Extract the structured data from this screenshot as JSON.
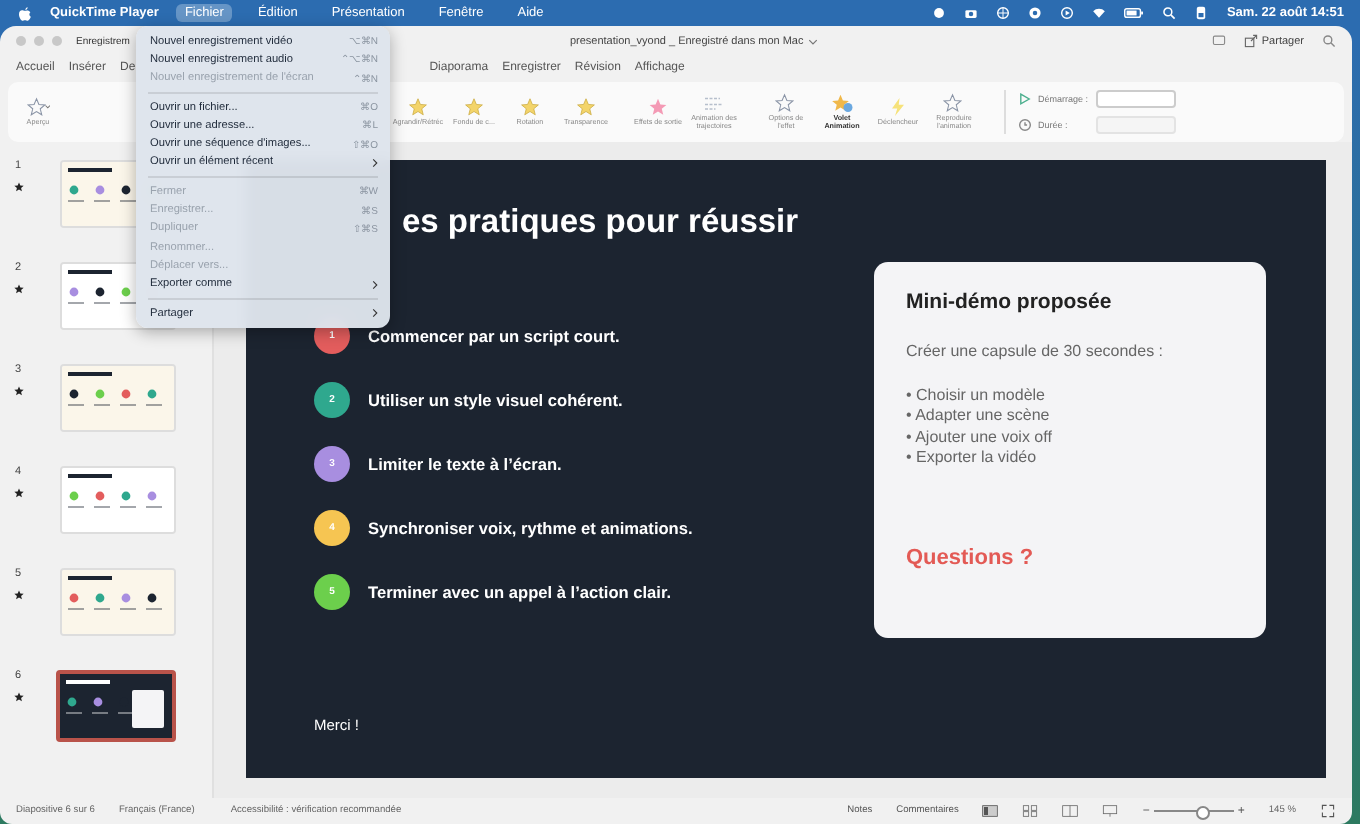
{
  "menu_bar": {
    "app": "QuickTime Player",
    "items": [
      {
        "label": "Fichier",
        "selected": true
      },
      {
        "label": "Édition",
        "selected": false
      },
      {
        "label": "Présentation",
        "selected": false
      },
      {
        "label": "Fenêtre",
        "selected": false
      },
      {
        "label": "Aide",
        "selected": false
      }
    ],
    "clock": "Sam. 22 août 14:51"
  },
  "window": {
    "left_tab": "Enregistrem",
    "title": "presentation_vyond _ Enregistré dans mon Mac",
    "share": "Partager"
  },
  "tabs": [
    {
      "label": "Accueil",
      "selected": false
    },
    {
      "label": "Insérer",
      "selected": false
    },
    {
      "label": "De",
      "selected": false
    },
    {
      "label": "Diaporama",
      "selected": false
    },
    {
      "label": "Enregistrer",
      "selected": false
    },
    {
      "label": "Révision",
      "selected": false
    },
    {
      "label": "Affichage",
      "selected": false
    }
  ],
  "ribbon": {
    "items": [
      {
        "label": "Aperçu"
      },
      {
        "label": "Agrandir/Rétréc"
      },
      {
        "label": "Fondu de c..."
      },
      {
        "label": "Rotation"
      },
      {
        "label": "Transparence"
      },
      {
        "label": "Effets de sortie"
      },
      {
        "label": "Animation des trajectoires"
      },
      {
        "label": "Options de l'effet"
      },
      {
        "label": "Volet Animation"
      },
      {
        "label": "Déclencheur"
      },
      {
        "label": "Reproduire l'animation"
      }
    ],
    "start_label": "Démarrage :",
    "duration_label": "Durée :"
  },
  "file_menu": {
    "items": [
      {
        "label": "Nouvel enregistrement vidéo",
        "shortcut": "⌥⌘N",
        "disabled": false,
        "submenu": false
      },
      {
        "label": "Nouvel enregistrement audio",
        "shortcut": "⌃⌥⌘N",
        "disabled": false,
        "submenu": false
      },
      {
        "label": "Nouvel enregistrement de l'écran",
        "shortcut": "⌃⌘N",
        "disabled": true,
        "submenu": false,
        "separator_after": true
      },
      {
        "label": "Ouvrir un fichier...",
        "shortcut": "⌘O",
        "disabled": false,
        "submenu": false
      },
      {
        "label": "Ouvrir une adresse...",
        "shortcut": "⌘L",
        "disabled": false,
        "submenu": false
      },
      {
        "label": "Ouvrir une séquence d'images...",
        "shortcut": "⇧⌘O",
        "disabled": false,
        "submenu": false
      },
      {
        "label": "Ouvrir un élément récent",
        "disabled": false,
        "submenu": true,
        "separator_after": true
      },
      {
        "label": "Fermer",
        "shortcut": "⌘W",
        "disabled": true,
        "submenu": false
      },
      {
        "label": "Enregistrer...",
        "shortcut": "⌘S",
        "disabled": true,
        "submenu": false
      },
      {
        "label": "Dupliquer",
        "shortcut": "⇧⌘S",
        "disabled": true,
        "submenu": false
      },
      {
        "label": "Renommer...",
        "disabled": true,
        "submenu": false
      },
      {
        "label": "Déplacer vers...",
        "disabled": true,
        "submenu": false
      },
      {
        "label": "Exporter comme",
        "disabled": false,
        "submenu": true,
        "separator_after": true
      },
      {
        "label": "Partager",
        "disabled": false,
        "submenu": true
      }
    ]
  },
  "slides_panel": {
    "slides": [
      {
        "number": "1",
        "kind": "cream",
        "selected": false
      },
      {
        "number": "2",
        "kind": "white",
        "selected": false
      },
      {
        "number": "3",
        "kind": "cream",
        "selected": false
      },
      {
        "number": "4",
        "kind": "white",
        "selected": false
      },
      {
        "number": "5",
        "kind": "cream",
        "selected": false
      },
      {
        "number": "6",
        "kind": "dark",
        "selected": true
      }
    ]
  },
  "slide": {
    "title": "es pratiques pour réussir",
    "steps": [
      {
        "number": "1",
        "text": "Commencer par un script court.",
        "color": "#e35d5d"
      },
      {
        "number": "2",
        "text": "Utiliser un style visuel cohérent.",
        "color": "#2fa88e"
      },
      {
        "number": "3",
        "text": "Limiter le texte à l’écran.",
        "color": "#a88ee0"
      },
      {
        "number": "4",
        "text": "Synchroniser voix, rythme et animations.",
        "color": "#f6c552"
      },
      {
        "number": "5",
        "text": "Terminer avec un appel à l’action clair.",
        "color": "#6ccf4c"
      }
    ],
    "card": {
      "title": "Mini-démo proposée",
      "intro": "Créer une capsule de 30 secondes :",
      "bullets": [
        "• Choisir un modèle",
        "• Adapter une scène",
        "• Ajouter une voix off",
        "• Exporter la vidéo"
      ],
      "question": "Questions ?"
    },
    "footer": "Merci !"
  },
  "status_bar": {
    "slide": "Diapositive 6 sur 6",
    "language": "Français (France)",
    "accessibility": "Accessibilité : vérification recommandée",
    "notes": "Notes",
    "comments": "Commentaires",
    "zoom_out": "−",
    "zoom": {
      "level": 0.6
    },
    "zoom_in": "+",
    "zoom_value": "145 %"
  }
}
